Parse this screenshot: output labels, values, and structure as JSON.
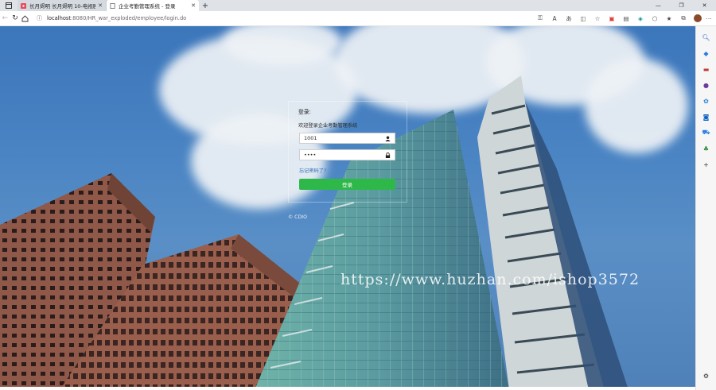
{
  "browser": {
    "tabs": [
      {
        "title": "长月烬明 长月烬明 10-电视剧-在线",
        "active": false
      },
      {
        "title": "企业考勤管理系统 - 登录",
        "active": true
      }
    ],
    "new_tab_label": "+",
    "address": {
      "host": "localhost",
      "path": ":8080/HR_war_exploded/employee/login.do"
    },
    "window_controls": [
      "—",
      "❐",
      "✕"
    ]
  },
  "login": {
    "title": "登录:",
    "subtitle": "欢迎登录企业考勤管理系统",
    "username": "1001",
    "password": "••••",
    "forgot": "忘记密码了?",
    "submit": "登录"
  },
  "footer": {
    "copyright": "© CDIO"
  },
  "watermark": "https://www.huzhan.com/ishop3572",
  "colors": {
    "login_button": "#2fb84a",
    "link": "#2b6cb0",
    "sky": "#4a84c3"
  }
}
